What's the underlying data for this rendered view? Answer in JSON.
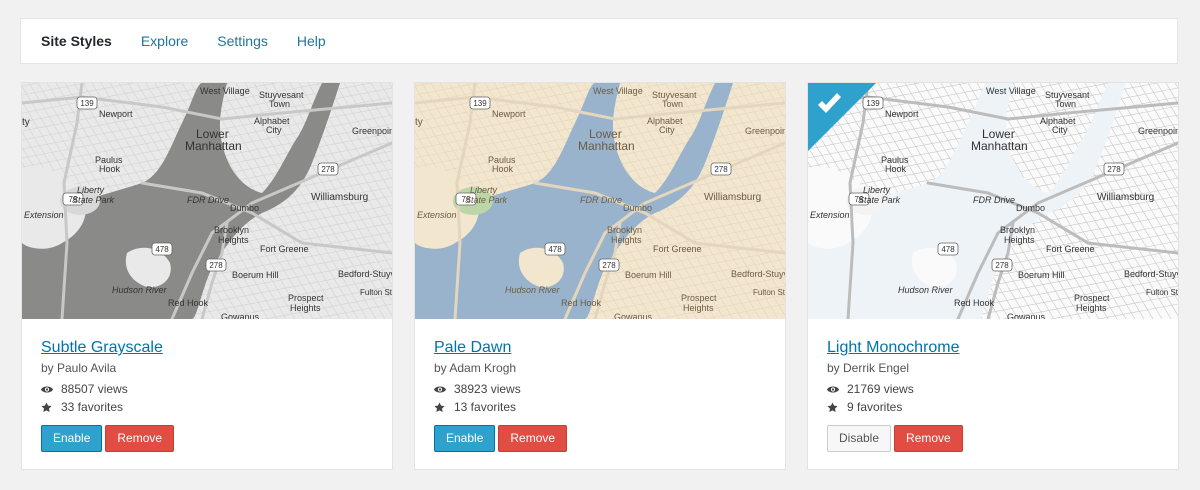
{
  "tabs": [
    {
      "label": "Site Styles"
    },
    {
      "label": "Explore"
    },
    {
      "label": "Settings"
    },
    {
      "label": "Help"
    }
  ],
  "map_labels": {
    "west_village": "West Village",
    "stuyvesant": "Stuyvesant",
    "town": "Town",
    "newport": "Newport",
    "route_139": "139",
    "lower": "Lower",
    "manhattan": "Manhattan",
    "alphabet": "Alphabet",
    "city": "City",
    "greenpoint": "Greenpoint",
    "paulus": "Paulus",
    "hook": "Hook",
    "route_78": "78",
    "route_278": "278",
    "williamsburg": "Williamsburg",
    "dumbo": "Dumbo",
    "brooklyn": "Brooklyn",
    "heights": "Heights",
    "fort_greene": "Fort Greene",
    "route_478": "478",
    "boerum_hill": "Boerum Hill",
    "bedford_stuy": "Bedford-Stuyvesant",
    "red_hook": "Red Hook",
    "prospect": "Prospect",
    "prospect_heights": "Heights",
    "fulton": "Fulton St",
    "gowanus": "Gowanus",
    "hudson_river": "Hudson River",
    "liberty": "Liberty",
    "state_park": "State Park",
    "fdr_drive": "FDR Drive",
    "extension": "Extension",
    "ty": "ty"
  },
  "cards": [
    {
      "title": "Subtle Grayscale",
      "author": "by Paulo Avila",
      "views": "88507 views",
      "favorites": "33 favorites",
      "primary_button": "Enable",
      "remove_button": "Remove",
      "active": false,
      "colors": {
        "land": "#e9e9e9",
        "water": "#8a8a88",
        "park": "#d8d8d8",
        "road": "#ffffff",
        "major": "#c8c8c8",
        "text": "#333333",
        "grid": "#d3d3d3"
      }
    },
    {
      "title": "Pale Dawn",
      "author": "by Adam Krogh",
      "views": "38923 views",
      "favorites": "13 favorites",
      "primary_button": "Enable",
      "remove_button": "Remove",
      "active": false,
      "colors": {
        "land": "#f2e6cf",
        "water": "#99b3cc",
        "park": "#bcd6a8",
        "road": "#ffffff",
        "major": "#e3d6bd",
        "text": "#6b5c45",
        "grid": "#e6d6b8"
      }
    },
    {
      "title": "Light Monochrome",
      "author": "by Derrik Engel",
      "views": "21769 views",
      "favorites": "9 favorites",
      "primary_button": "Disable",
      "remove_button": "Remove",
      "active": true,
      "colors": {
        "land": "#fafafa",
        "water": "#eef3f8",
        "park": "#f3f3f3",
        "road": "#ffffff",
        "major": "#bcbcbc",
        "text": "#333333",
        "grid": "#c8c8c8"
      }
    }
  ],
  "accent_colors": {
    "link": "#0073aa",
    "enable": "#2ea2cc",
    "remove": "#e14d43",
    "active_check": "#2ea2cc"
  },
  "icons": {
    "views": "eye-icon",
    "favorites": "star-icon",
    "active": "checkmark-icon"
  }
}
